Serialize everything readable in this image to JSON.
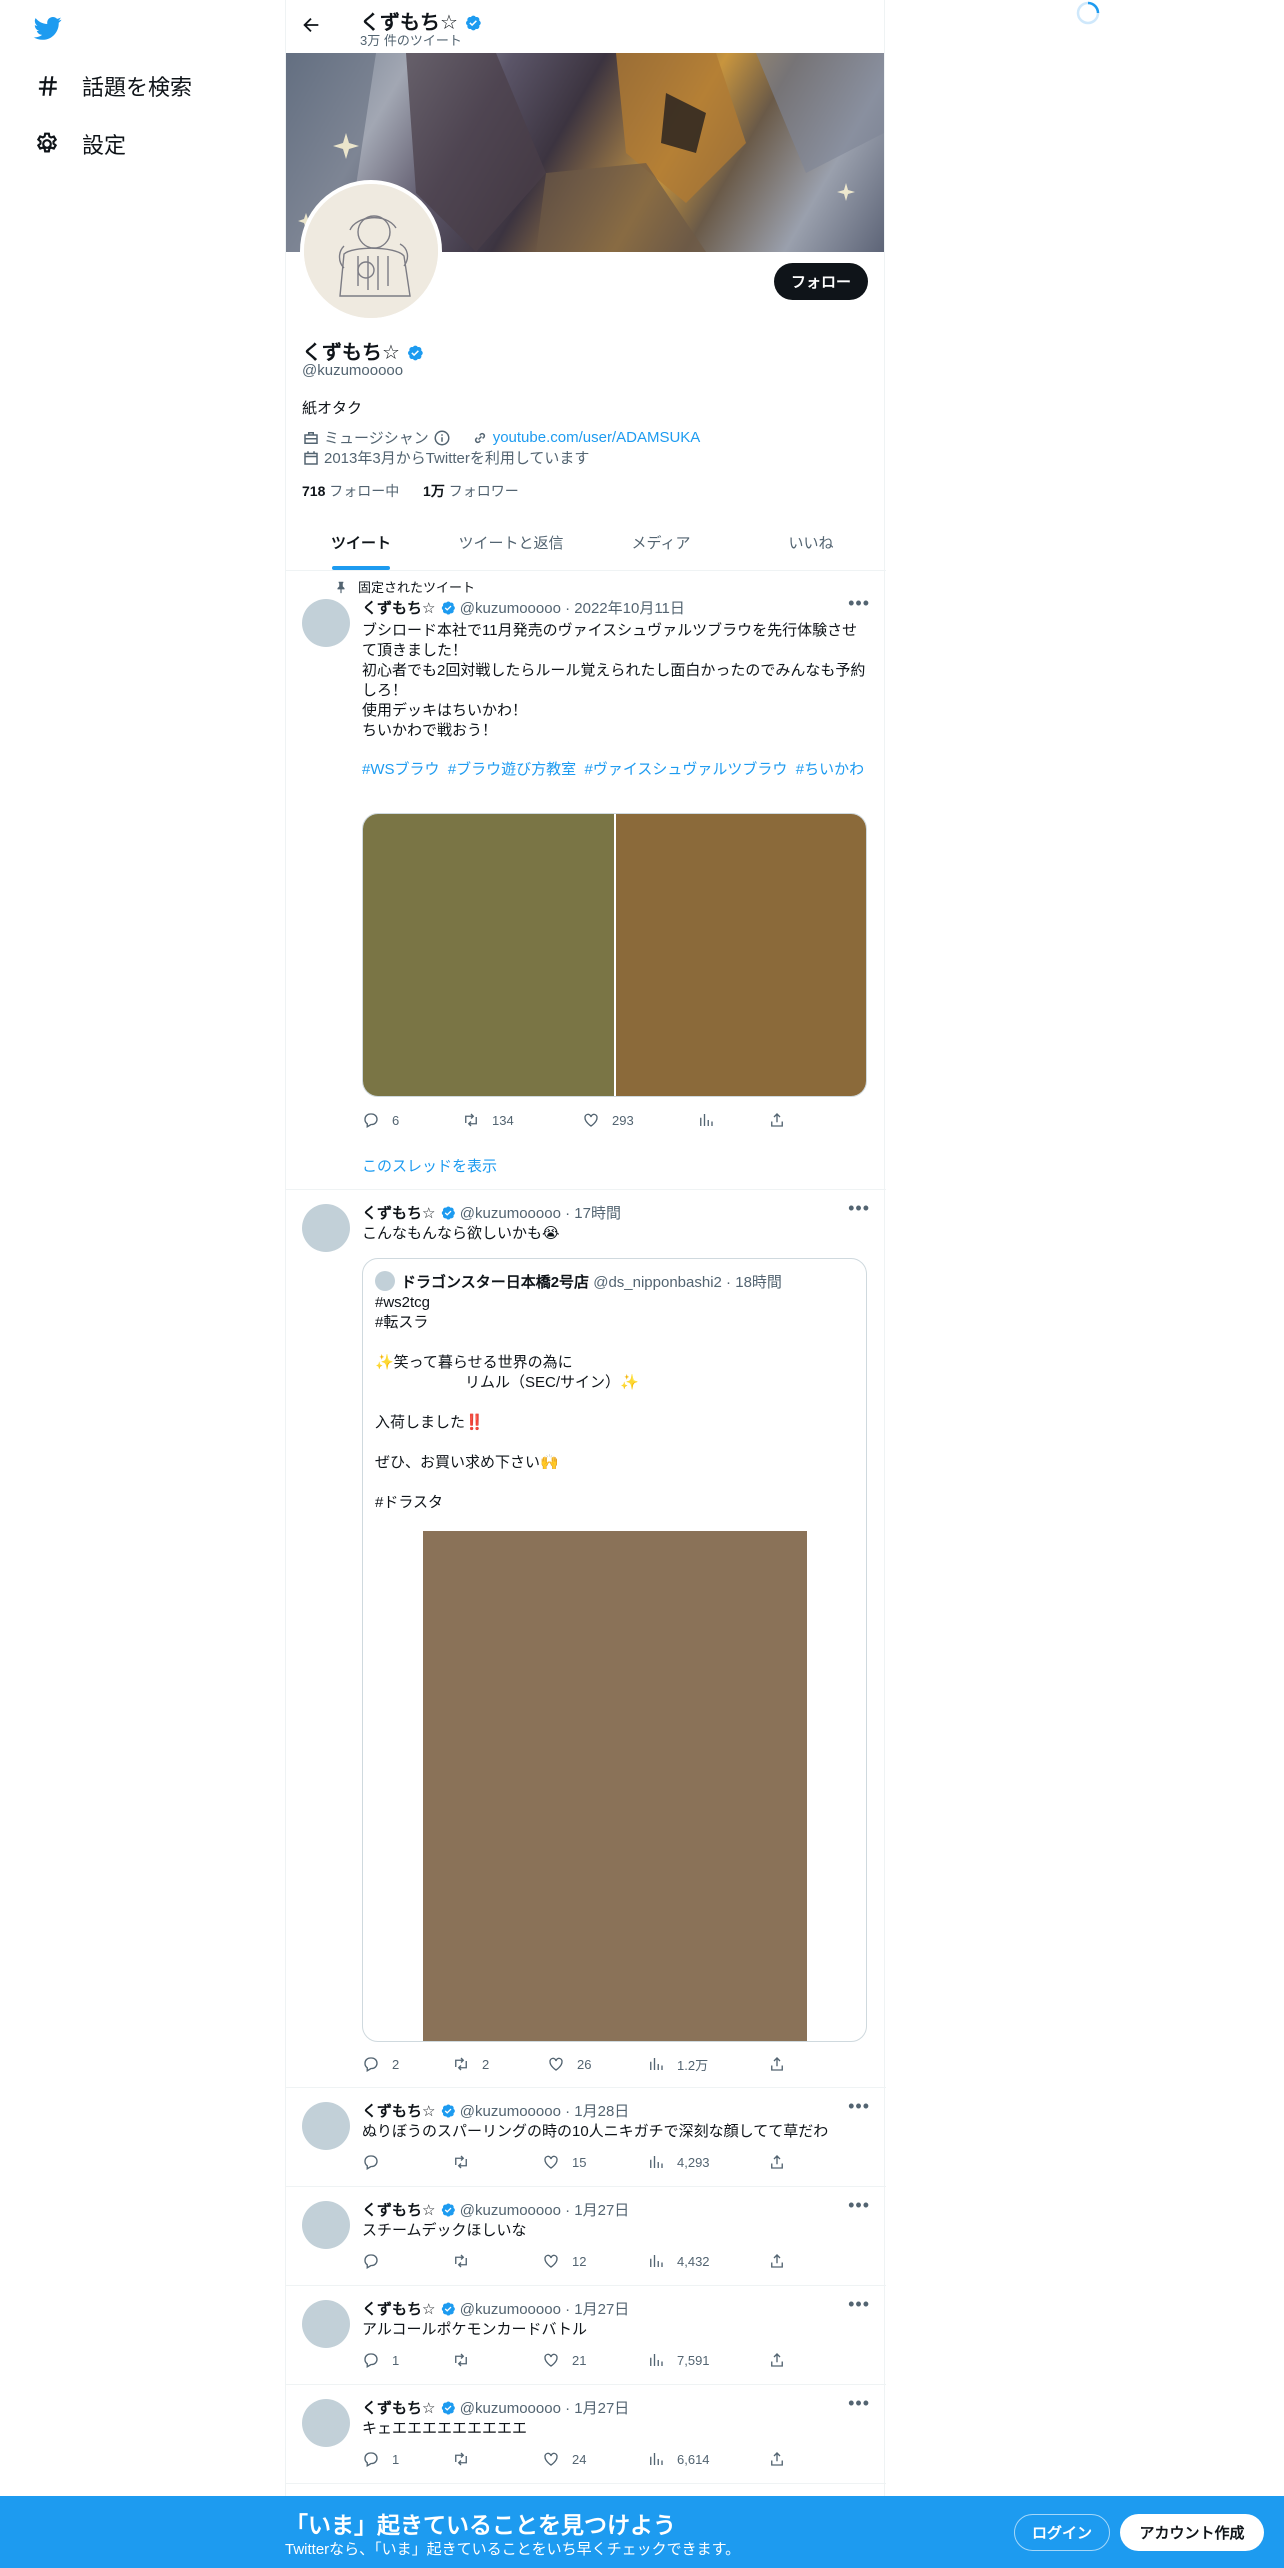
{
  "nav": {
    "explore_label": "話題を検索",
    "settings_label": "設定"
  },
  "header": {
    "name": "くずもち☆",
    "tweet_count": "3万 件のツイート"
  },
  "profile": {
    "name": "くずもち☆",
    "handle": "@kuzumooooo",
    "follow_label": "フォロー",
    "bio": "紙オタク",
    "category": "ミュージシャン",
    "link": "youtube.com/user/ADAMSUKA",
    "joined": "2013年3月からTwitterを利用しています",
    "following_count": "718",
    "following_label": "フォロー中",
    "followers_count": "1万",
    "followers_label": "フォロワー"
  },
  "tabs": [
    "ツイート",
    "ツイートと返信",
    "メディア",
    "いいね"
  ],
  "tweets": {
    "pinned": {
      "pinned_label": "固定されたツイート",
      "name": "くずもち☆",
      "handle": "@kuzumooooo",
      "time": "2022年10月11日",
      "text": "ブシロード本社で11月発売のヴァイスシュヴァルツブラウを先行体験させて頂きました！\n初心者でも2回対戦したらルール覚えられたし面白かったのでみんなも予約しろ！\n使用デッキはちいかわ！\nちいかわで戦おう！",
      "hashtags": "#WSブラウ  #ブラウ遊び方教室  #ヴァイスシュヴァルツブラウ  #ちいかわ",
      "image_colors": [
        "#7a7545",
        "#8b6a3a"
      ],
      "replies": "6",
      "retweets": "134",
      "likes": "293",
      "thread_link": "このスレッドを表示"
    },
    "t2": {
      "name": "くずもち☆",
      "handle": "@kuzumooooo",
      "time": "17時間",
      "text": "こんなもんなら欲しいかも😭",
      "quote": {
        "name": "ドラゴンスター日本橋2号店",
        "handle": "@ds_nipponbashi2",
        "time": "18時間",
        "text": "#ws2tcg\n#転スラ\n\n✨笑って暮らせる世界の為に\n　　　　　　リムル（SEC/サイン）✨\n\n入荷しました‼️\n\nぜひ、お買い求め下さい🙌\n\n#ドラスタ",
        "image_color": "#8a7258"
      },
      "replies": "2",
      "retweets": "2",
      "likes": "26",
      "views": "1.2万"
    },
    "t3": {
      "name": "くずもち☆",
      "handle": "@kuzumooooo",
      "time": "1月28日",
      "text": "ぬりぼうのスパーリングの時の10人ニキガチで深刻な顔してて草だわ",
      "replies": "",
      "retweets": "",
      "likes": "15",
      "views": "4,293"
    },
    "t4": {
      "name": "くずもち☆",
      "handle": "@kuzumooooo",
      "time": "1月27日",
      "text": "スチームデックほしいな",
      "replies": "",
      "retweets": "",
      "likes": "12",
      "views": "4,432"
    },
    "t5": {
      "name": "くずもち☆",
      "handle": "@kuzumooooo",
      "time": "1月27日",
      "text": "アルコールポケモンカードバトル",
      "replies": "1",
      "retweets": "",
      "likes": "21",
      "views": "7,591"
    },
    "t6": {
      "name": "くずもち☆",
      "handle": "@kuzumooooo",
      "time": "1月27日",
      "text": "キェエエエエエエエエエ",
      "replies": "1",
      "retweets": "",
      "likes": "24",
      "views": "6,614"
    }
  },
  "bottom_bar": {
    "headline": "「いま」起きていることを見つけよう",
    "sub": "Twitterなら、「いま」起きていることをいち早くチェックできます。",
    "login_label": "ログイン",
    "signup_label": "アカウント作成"
  },
  "colors": {
    "accent": "#1d9bf0",
    "text": "#0f1419",
    "muted": "#536471"
  }
}
